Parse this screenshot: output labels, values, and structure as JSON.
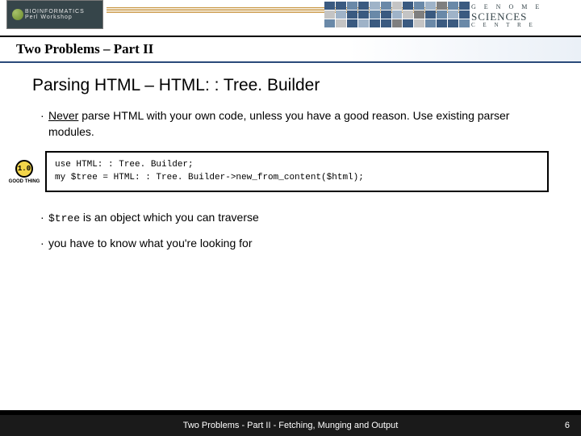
{
  "banner": {
    "logo_top": "BIOINFORMATICS",
    "logo_bottom": "Perl Workshop",
    "right_line1": "G E N O M E",
    "right_line2": "SCIENCES",
    "right_line3": "C E N T R E"
  },
  "title": "Two Problems – Part II",
  "heading": "Parsing HTML – HTML: : Tree. Builder",
  "bullets": {
    "b1_underline": "Never",
    "b1_rest": " parse HTML with your own code, unless you have a good reason. Use existing parser modules.",
    "b2_code": "$tree",
    "b2_rest": " is an object which you can traverse",
    "b3": "you have to know what you're looking for"
  },
  "badge": {
    "num": "1.0",
    "caption": "GOOD\nTHING"
  },
  "code": "use HTML: : Tree. Builder;\nmy $tree = HTML: : Tree. Builder->new_from_content($html);",
  "footer": {
    "text": "Two Problems - Part II - Fetching, Munging and Output",
    "page": "6"
  }
}
